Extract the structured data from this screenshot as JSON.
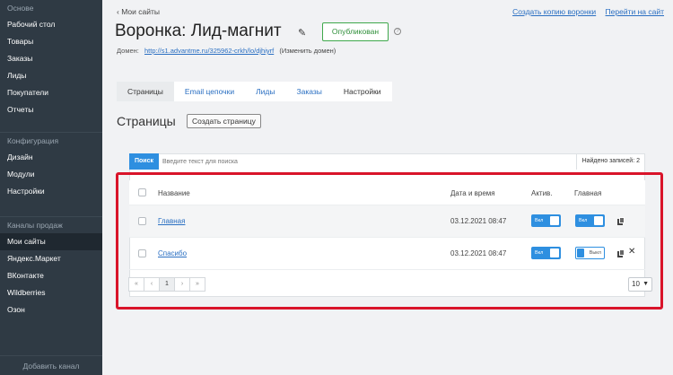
{
  "sidebar": {
    "groups": [
      {
        "heading": "Основе",
        "items": [
          "Рабочий стол",
          "Товары",
          "Заказы",
          "Лиды",
          "Покупатели",
          "Отчеты"
        ]
      },
      {
        "heading": "Конфигурация",
        "items": [
          "Дизайн",
          "Модули",
          "Настройки"
        ]
      },
      {
        "heading": "Каналы продаж",
        "items": [
          "Мои сайты",
          "Яндекс.Маркет",
          "ВКонтакте",
          "Wildberries",
          "Озон"
        ]
      }
    ],
    "active_item": "Мои сайты",
    "bottom_label": "Добавить канал"
  },
  "header": {
    "back_label": "Мои сайты",
    "links": [
      "Создать копию воронки",
      "Перейти на сайт"
    ],
    "title": "Воронка: Лид-магнит",
    "status_label": "Опубликован",
    "domain_label": "Домен:",
    "domain_url": "http://s1.advantme.ru/325962-crkh/lo/djhiyrf",
    "domain_change": "(Изменить домен)"
  },
  "tabs": [
    {
      "label": "Страницы",
      "active": true
    },
    {
      "label": "Email цепочки",
      "active": false
    },
    {
      "label": "Лиды",
      "active": false
    },
    {
      "label": "Заказы",
      "active": false
    },
    {
      "label": "Настройки",
      "active": false
    }
  ],
  "section": {
    "title": "Страницы",
    "create_label": "Создать страницу"
  },
  "search": {
    "button_label": "Поиск",
    "placeholder": "Введите текст для поиска",
    "found_label": "Найдено записей: 2"
  },
  "table": {
    "columns": {
      "name": "Название",
      "date": "Дата и время",
      "active": "Актив.",
      "main": "Главная"
    },
    "rows": [
      {
        "name": "Главная",
        "date": "03.12.2021 08:47",
        "active_label": "Вкл",
        "main_label": "Вкл",
        "active_on": true,
        "main_on": true
      },
      {
        "name": "Спасибо",
        "date": "03.12.2021 08:47",
        "active_label": "Вкл",
        "main_label": "Выкл",
        "active_on": true,
        "main_on": false
      }
    ]
  },
  "pager": {
    "first": "«",
    "prev": "‹",
    "current": "1",
    "next": "›",
    "last": "»",
    "per_page": "10"
  },
  "colors": {
    "accent": "#2e8fe0",
    "highlight_frame": "#d9142a",
    "published": "#3fa84b",
    "sidebar": "#2f3a44"
  }
}
